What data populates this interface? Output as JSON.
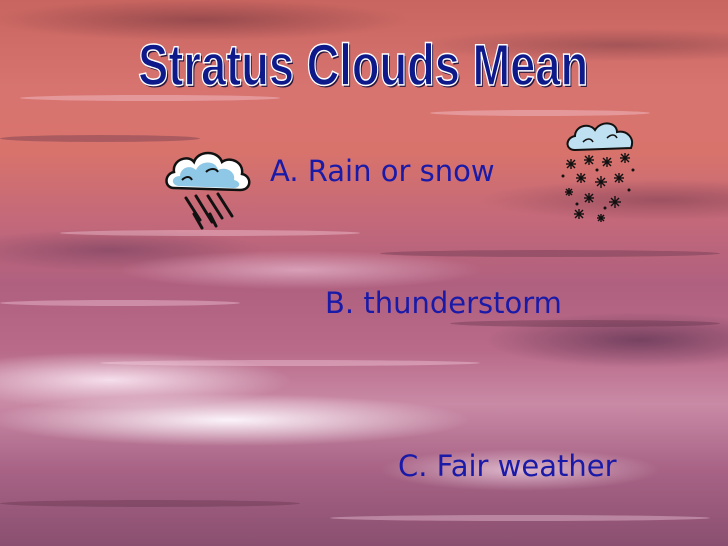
{
  "slide": {
    "title": "Stratus Clouds Mean",
    "answers": [
      {
        "label": "A. Rain or snow"
      },
      {
        "label": "B. thunderstorm"
      },
      {
        "label": "C. Fair weather"
      }
    ],
    "icons": [
      "rain-cloud-icon",
      "snow-cloud-icon"
    ],
    "colors": {
      "title": "#0f1a8a",
      "answer_text": "#1a1aa8",
      "sky_top": "#c96560",
      "sky_bottom": "#8a4f70"
    }
  }
}
